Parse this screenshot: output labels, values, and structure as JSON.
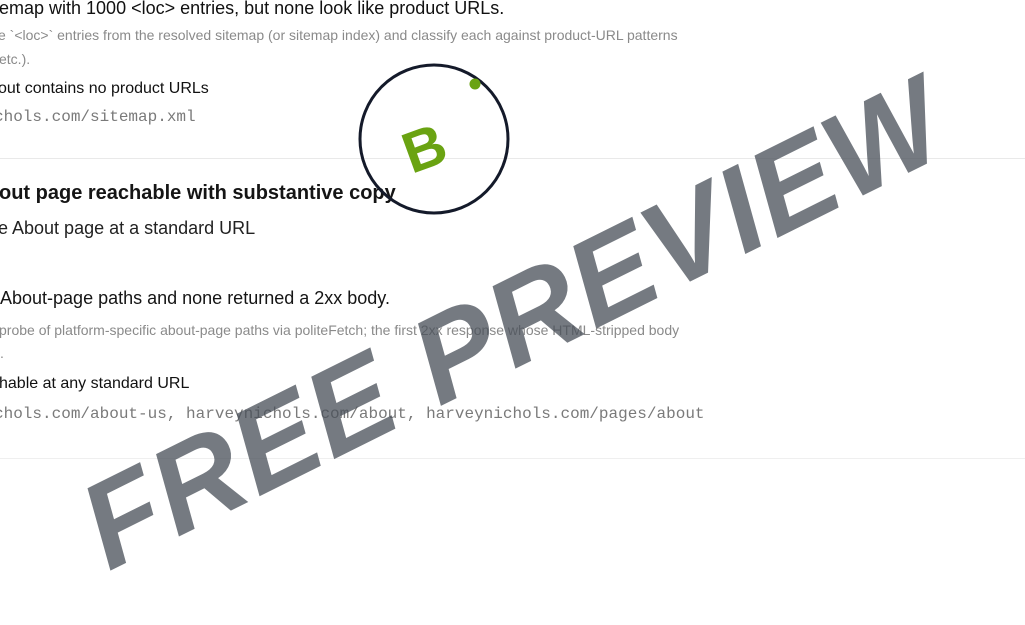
{
  "sitemap_check": {
    "heading": "emap with 1000 <loc> entries, but none look like product URLs.",
    "description": "e `<loc>` entries from the resolved sitemap (or sitemap index) and classify each against product-URL patterns",
    "description_cont": "etc.).",
    "verdict": "out contains no product URLs",
    "evidence_url": "chols.com/sitemap.xml"
  },
  "about_check": {
    "title": "out page reachable with substantive copy",
    "subtitle": "e About page at a standard URL",
    "finding": "About-page paths and none returned a 2xx body.",
    "description": "probe of platform-specific about-page paths via politeFetch; the first 2xx response whose HTML-stripped body",
    "description_cont": ".",
    "verdict": "hable at any standard URL",
    "evidence_urls": "chols.com/about-us, harveynichols.com/about, harveynichols.com/pages/about"
  },
  "grade_badge": {
    "letter": "B",
    "letter_color": "#6aa312",
    "ring_color": "#141a2a",
    "dot_color": "#6aa312"
  },
  "watermark": {
    "text": "FREE PREVIEW",
    "color": "#4a505a"
  }
}
